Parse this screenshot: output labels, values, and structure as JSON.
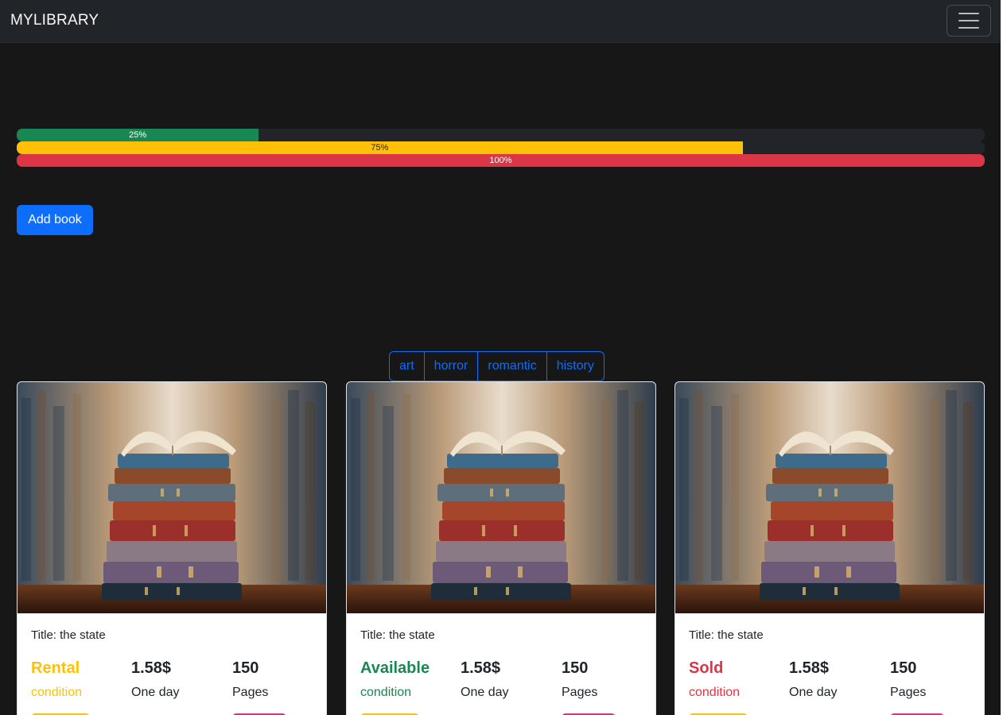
{
  "navbar": {
    "brand": "MYLIBRARY",
    "toggler_icon": "hamburger-menu-icon"
  },
  "progress": [
    {
      "label": "25%",
      "value": 25,
      "color": "#198754",
      "text_color": "#ffffff"
    },
    {
      "label": "75%",
      "value": 75,
      "color": "#ffc107",
      "text_color": "#212529"
    },
    {
      "label": "100%",
      "value": 100,
      "color": "#dc3545",
      "text_color": "#ffffff"
    }
  ],
  "actions": {
    "add_book_label": "Add book"
  },
  "filters": [
    "art",
    "horror",
    "romantic",
    "history"
  ],
  "cards": [
    {
      "image": "stack-of-books-photo",
      "title": "Title: the state",
      "status": "Rental",
      "status_label": "condition",
      "status_color": "#ffc107",
      "price": "1.58$",
      "price_label": "One day",
      "pages": "150",
      "pages_label": "Pages"
    },
    {
      "image": "stack-of-books-photo",
      "title": "Title: the state",
      "status": "Available",
      "status_label": "condition",
      "status_color": "#198754",
      "price": "1.58$",
      "price_label": "One day",
      "pages": "150",
      "pages_label": "Pages"
    },
    {
      "image": "stack-of-books-photo",
      "title": "Title: the state",
      "status": "Sold",
      "status_label": "condition",
      "status_color": "#dc3545",
      "price": "1.58$",
      "price_label": "One day",
      "pages": "150",
      "pages_label": "Pages"
    }
  ]
}
